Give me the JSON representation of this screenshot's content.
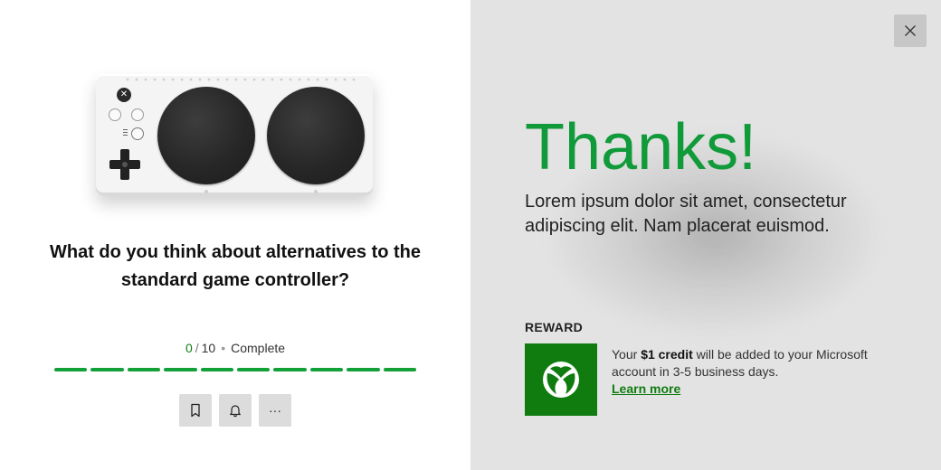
{
  "survey": {
    "question": "What do you think about alternatives to the standard game controller?",
    "progress": {
      "answered": "0",
      "separator": "/",
      "total": "10",
      "status": "Complete",
      "segments": 10,
      "complete_fraction": 1.0
    },
    "actions": [
      {
        "name": "bookmark-button",
        "icon": "bookmark-icon"
      },
      {
        "name": "notification-button",
        "icon": "bell-icon"
      },
      {
        "name": "more-options-button",
        "icon": "ellipsis-icon",
        "label": "···"
      }
    ]
  },
  "thanks_panel": {
    "heading": "Thanks!",
    "description": "Lorem ipsum dolor sit amet, consectetur adipiscing elit. Nam placerat euismod.",
    "reward": {
      "label": "REWARD",
      "text_before": "Your ",
      "credit": "$1 credit",
      "text_after": " will be added to your Microsoft account in 3-5 business days.",
      "link": "Learn more",
      "icon": "xbox-logo-icon"
    },
    "close_icon": "close-icon"
  },
  "colors": {
    "accent_green": "#107c10",
    "heading_green": "#109a3a",
    "progress_green": "#14a038",
    "right_panel_bg": "#e3e3e3"
  }
}
